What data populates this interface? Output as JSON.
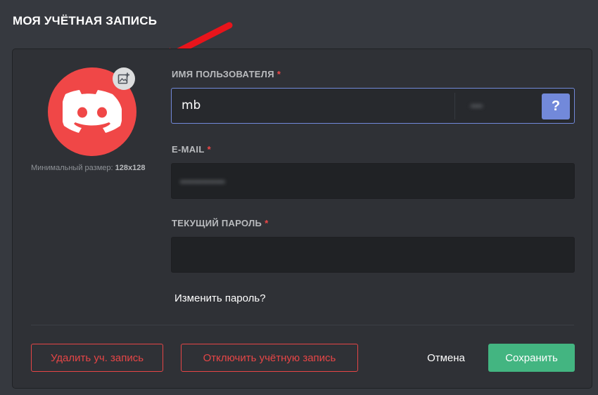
{
  "header": {
    "title": "МОЯ УЧЁТНАЯ ЗАПИСЬ"
  },
  "avatar": {
    "icon": "discord-logo-icon",
    "upload_icon": "add-image-icon",
    "min_size_label": "Минимальный размер:",
    "min_size_value": "128x128",
    "color": "#f04747"
  },
  "fields": {
    "username": {
      "label": "ИМЯ ПОЛЬЗОВАТЕЛЯ",
      "required_mark": "*",
      "value": "mb",
      "discriminator": "••••",
      "help_label": "?"
    },
    "email": {
      "label": "E-MAIL",
      "required_mark": "*",
      "value": "••••••••••••••"
    },
    "password": {
      "label": "ТЕКУЩИЙ ПАРОЛЬ",
      "required_mark": "*",
      "value": ""
    }
  },
  "links": {
    "change_password": "Изменить пароль?"
  },
  "actions": {
    "delete": "Удалить уч. запись",
    "disable": "Отключить учётную запись",
    "cancel": "Отмена",
    "save": "Сохранить"
  },
  "colors": {
    "accent": "#7289da",
    "danger": "#f04747",
    "success": "#43b581",
    "annotation_arrow": "#e8141b"
  }
}
